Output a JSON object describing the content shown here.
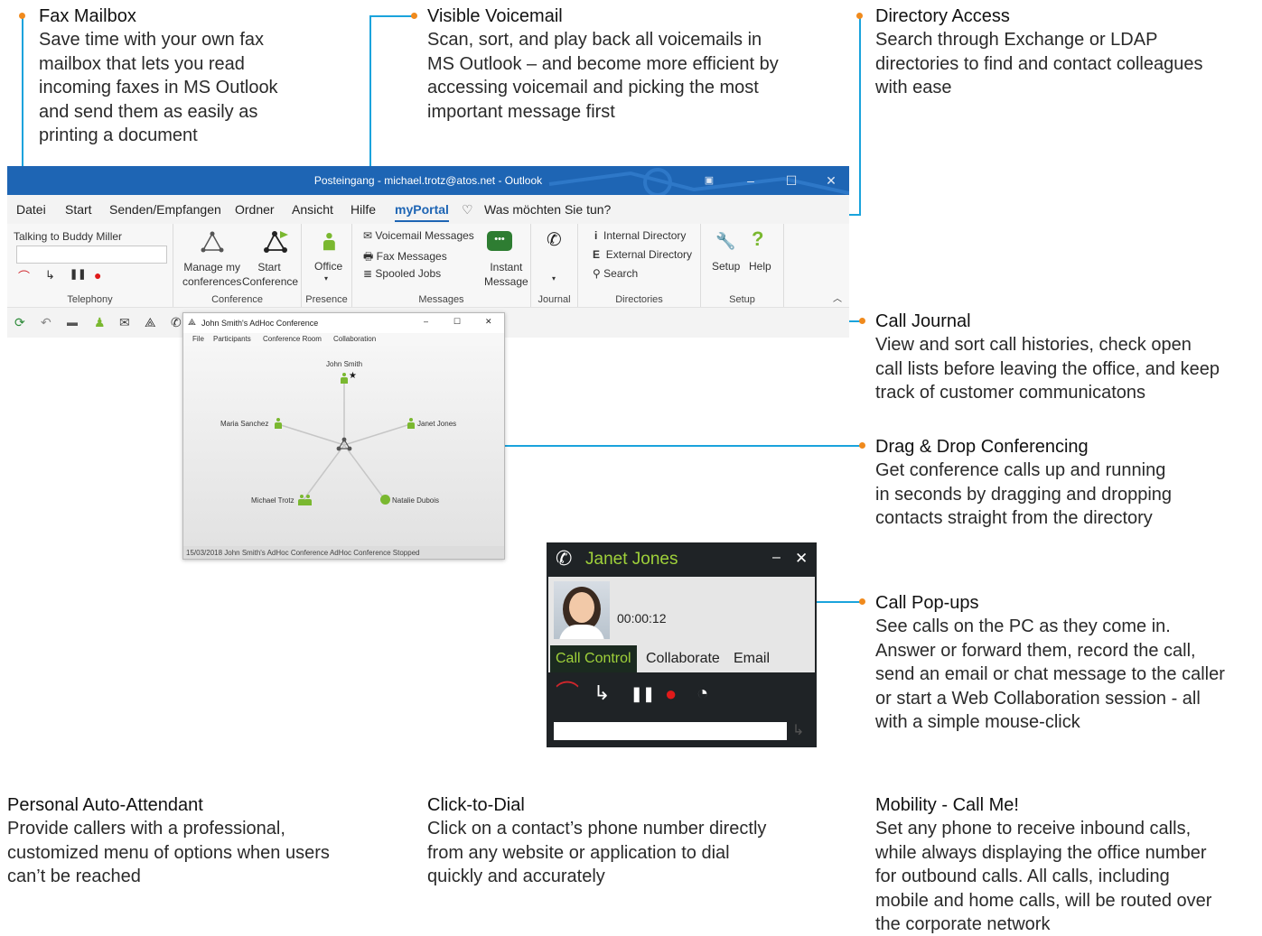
{
  "callouts": {
    "fax": {
      "title": "Fax Mailbox",
      "desc": "Save time with your own fax\nmailbox that lets you read\nincoming faxes in MS Outlook\nand send them as easily as\nprinting a document"
    },
    "voicemail": {
      "title": "Visible Voicemail",
      "desc": "Scan, sort, and play back all voicemails in\nMS Outlook – and become more efficient by\naccessing voicemail and picking the most\nimportant message first"
    },
    "directory": {
      "title": "Directory Access",
      "desc": "Search through Exchange or LDAP\ndirectories to find and contact colleagues\nwith ease"
    },
    "journal": {
      "title": "Call Journal",
      "desc": "View and sort call histories, check open\ncall lists before leaving the office, and keep\ntrack of customer communicatons"
    },
    "dragdrop": {
      "title": "Drag & Drop Conferencing",
      "desc": "Get conference calls up and running\nin seconds by dragging and dropping\ncontacts straight from the directory"
    },
    "popups": {
      "title": "Call Pop-ups",
      "desc": "See calls on the PC as they come in.\nAnswer or forward them, record the call,\nsend an email or chat message to the caller\nor start a Web Collaboration session - all\nwith a simple mouse-click"
    },
    "attendant": {
      "title": "Personal Auto-Attendant",
      "desc": "Provide callers with a professional,\ncustomized menu of options when users\ncan’t be reached"
    },
    "clicktodial": {
      "title": "Click-to-Dial",
      "desc": "Click on a contact’s phone number directly\nfrom any website or application to dial\nquickly and accurately"
    },
    "mobility": {
      "title": "Mobility - Call Me!",
      "desc": "Set any phone to receive inbound calls,\nwhile always displaying the office number\nfor outbound calls. All calls, including\nmobile and home calls, will be routed over\nthe corporate network"
    }
  },
  "outlook": {
    "window_title": "Posteingang - michael.trotz@atos.net  -  Outlook",
    "menu": [
      "Datei",
      "Start",
      "Senden/Empfangen",
      "Ordner",
      "Ansicht",
      "Hilfe",
      "myPortal"
    ],
    "tell_me": "Was möchten Sie tun?",
    "ribbon": {
      "talking_to": "Talking to Buddy Miller",
      "telephony_label": "Telephony",
      "manage_conf_1": "Manage my",
      "manage_conf_2": "conferences",
      "start_conf_1": "Start",
      "start_conf_2": "Conference",
      "conference_label": "Conference",
      "office": "Office",
      "presence_label": "Presence",
      "voicemail_messages": "Voicemail Messages",
      "fax_messages": "Fax Messages",
      "spooled_jobs": "Spooled Jobs",
      "instant_1": "Instant",
      "instant_2": "Message",
      "messages_label": "Messages",
      "journal_label": "Journal",
      "internal_directory": "Internal Directory",
      "external_directory": "External Directory",
      "search": "Search",
      "directories_label": "Directories",
      "setup": "Setup",
      "help": "Help",
      "setup_label": "Setup"
    }
  },
  "conference": {
    "title": "John Smith's AdHoc Conference",
    "menu": [
      "File",
      "Participants",
      "Conference Room",
      "Collaboration"
    ],
    "participants": [
      "John Smith",
      "Maria Sanchez",
      "Janet Jones",
      "Michael Trotz",
      "Natalie Dubois"
    ],
    "status": "15/03/2018   John Smith's AdHoc Conference   AdHoc Conference   Stopped"
  },
  "popup": {
    "caller": "Janet Jones",
    "timer": "00:00:12",
    "tabs": [
      "Call Control",
      "Collaborate",
      "Email"
    ]
  },
  "colors": {
    "accent_line": "#1aa3dc",
    "dot": "#f08a1d",
    "outlook_blue": "#1e65b4",
    "presence_green": "#7ab830",
    "popup_green": "#9fd13a"
  }
}
